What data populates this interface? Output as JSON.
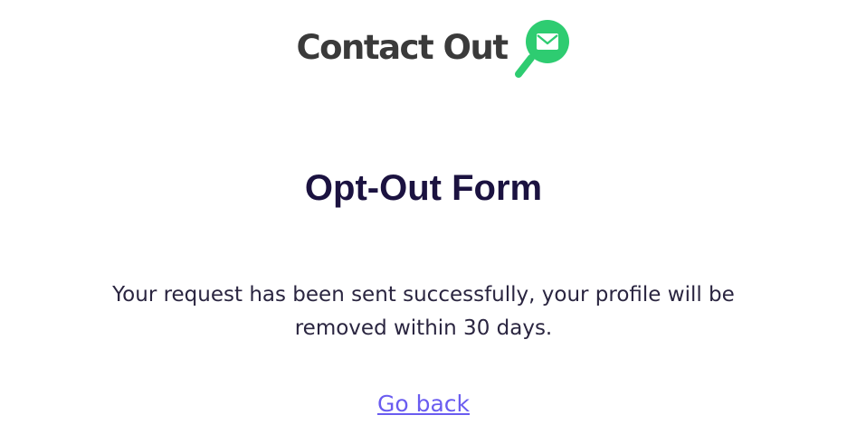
{
  "header": {
    "logo_text": "Contact Out",
    "logo_icon": "magnifier-envelope-icon",
    "brand_color": "#2ecc71"
  },
  "main": {
    "title": "Opt-Out Form",
    "message_line1": "Your request has been sent successfully, your profile will be",
    "message_line2": "removed within 30 days.",
    "go_back_label": "Go back",
    "link_color": "#6a5cf0",
    "title_color": "#1b1240"
  }
}
